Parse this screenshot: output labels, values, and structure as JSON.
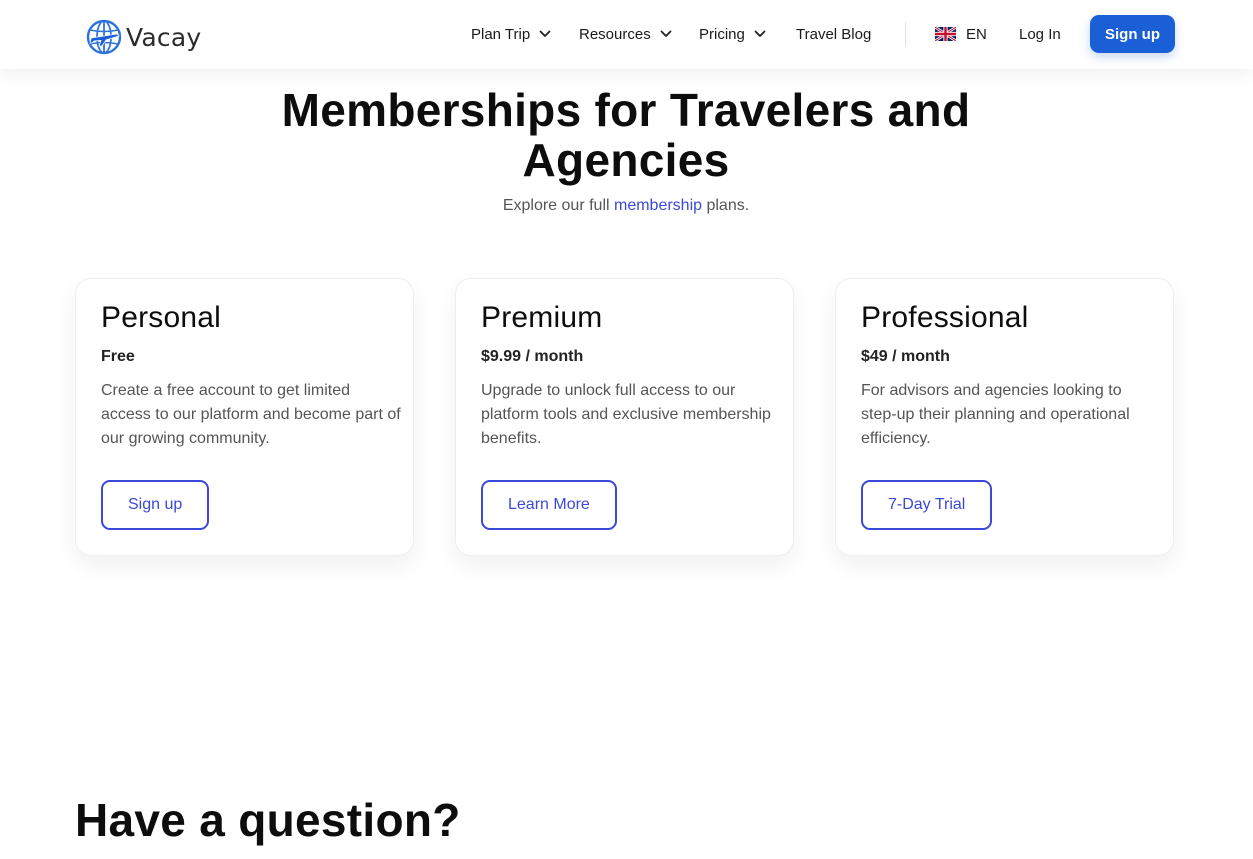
{
  "brand": {
    "name": "Vacay",
    "accent": "#1a5fd6",
    "link_color": "#3b48d8"
  },
  "nav": {
    "items": [
      {
        "label": "Plan Trip",
        "has_dropdown": true,
        "icon": "chevron-down-icon"
      },
      {
        "label": "Resources",
        "has_dropdown": true,
        "icon": "chevron-down-icon"
      },
      {
        "label": "Pricing",
        "has_dropdown": true,
        "icon": "chevron-down-icon"
      },
      {
        "label": "Travel Blog",
        "has_dropdown": false
      }
    ],
    "language": {
      "code": "EN",
      "icon": "uk-flag-icon"
    },
    "login_label": "Log In",
    "signup_label": "Sign up"
  },
  "hero": {
    "title": "Memberships for Travelers and Agencies",
    "subtitle_before": "Explore our full ",
    "subtitle_link": "membership",
    "subtitle_after": " plans."
  },
  "plans": [
    {
      "name": "Personal",
      "price": "Free",
      "description": "Create a free account to get limited access to our platform and become part of our growing community.",
      "button": "Sign up"
    },
    {
      "name": "Premium",
      "price": "$9.99 / month",
      "description": "Upgrade to unlock full access to our platform tools and exclusive membership benefits.",
      "button": "Learn More"
    },
    {
      "name": "Professional",
      "price": "$49 / month",
      "description": "For advisors and agencies looking to step-up their planning and operational efficiency.",
      "button": "7-Day Trial"
    }
  ],
  "faq": {
    "title": "Have a question?"
  }
}
